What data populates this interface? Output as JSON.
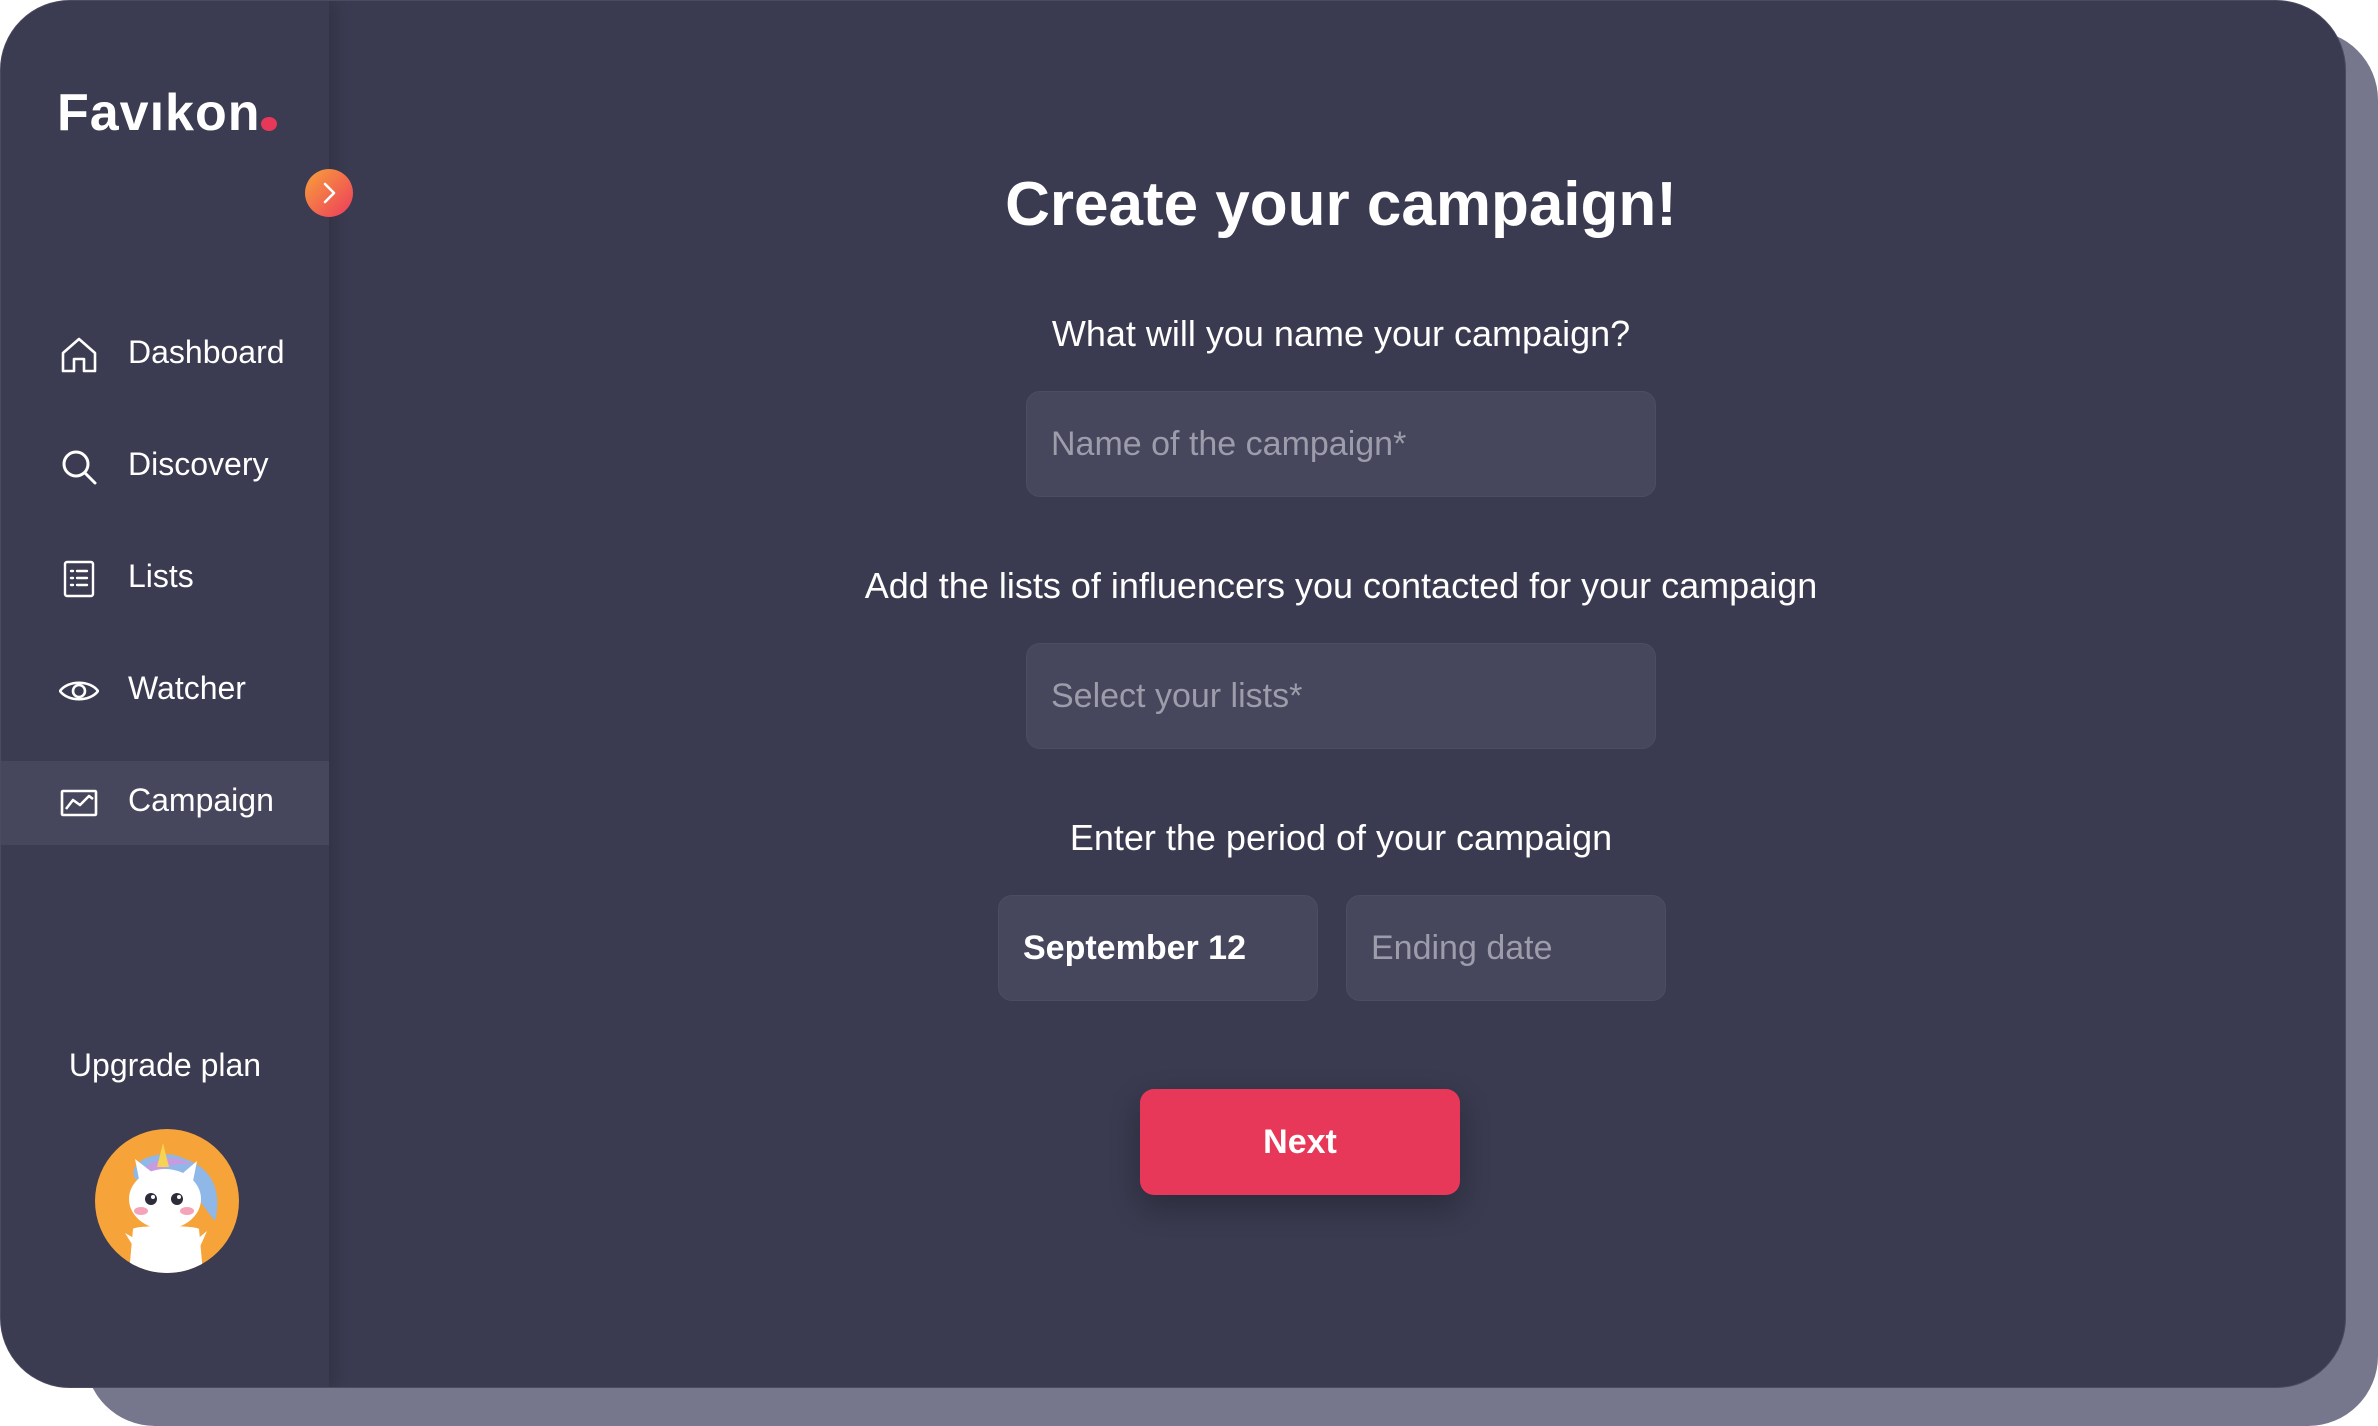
{
  "app": {
    "logo_text": "Favıkon"
  },
  "sidebar": {
    "items": [
      {
        "label": "Dashboard",
        "icon": "home-icon"
      },
      {
        "label": "Discovery",
        "icon": "search-icon"
      },
      {
        "label": "Lists",
        "icon": "list-icon"
      },
      {
        "label": "Watcher",
        "icon": "eye-icon"
      },
      {
        "label": "Campaign",
        "icon": "chart-icon",
        "active": true
      }
    ],
    "upgrade_label": "Upgrade plan",
    "avatar_icon": "unicorn-avatar"
  },
  "main": {
    "title": "Create your campaign!",
    "name_question": "What will you name your campaign?",
    "name_placeholder": "Name of the campaign*",
    "lists_question": "Add the lists of influencers you contacted for your campaign",
    "lists_placeholder": "Select your lists*",
    "period_question": "Enter the period of your campaign",
    "start_date_value": "September 12",
    "end_date_placeholder": "Ending date",
    "next_label": "Next"
  },
  "colors": {
    "background": "#3a3a50",
    "accent": "#e8385a",
    "field": "#46465c"
  }
}
